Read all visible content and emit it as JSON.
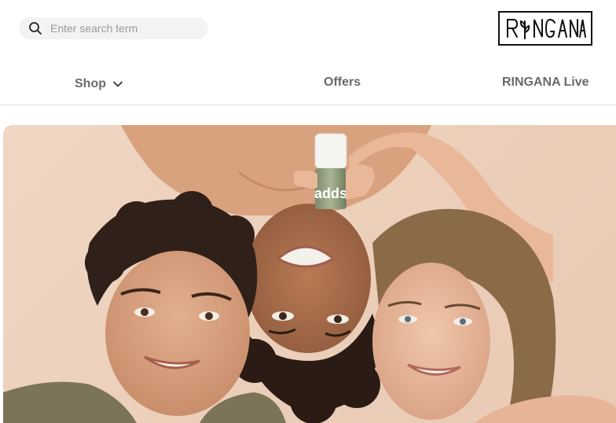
{
  "search": {
    "placeholder": "Enter search term",
    "value": "",
    "icon": "search-icon"
  },
  "brand": {
    "logo_text": "RINGANA"
  },
  "nav": {
    "items": [
      {
        "label": "Shop",
        "icon": "chevron-down-icon"
      },
      {
        "label": "Offers"
      },
      {
        "label": "RINGANA Live"
      }
    ]
  },
  "hero": {
    "product_label": "adds",
    "colors": {
      "background": "#ecd0bb",
      "skin": "#d9a584",
      "hair_dark": "#3b2a20",
      "hair_light": "#8a6a4a",
      "shirt": "#7a7358"
    }
  }
}
